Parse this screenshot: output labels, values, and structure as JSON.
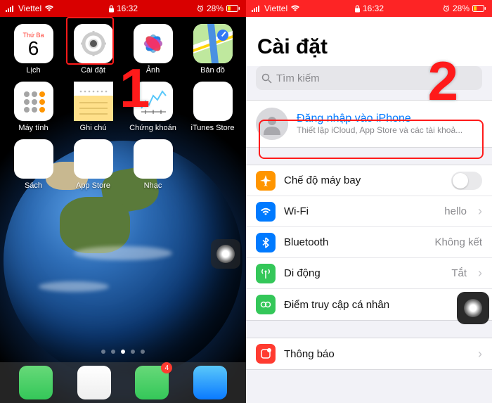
{
  "status": {
    "carrier": "Viettel",
    "time": "16:32",
    "battery_pct": "28%"
  },
  "annotations": {
    "step1": "1",
    "step2": "2"
  },
  "home": {
    "calendar": {
      "dow": "Thứ Ba",
      "day": "6"
    },
    "apps": [
      {
        "label": "Lịch"
      },
      {
        "label": "Cài đặt"
      },
      {
        "label": "Ảnh"
      },
      {
        "label": "Bản đồ"
      },
      {
        "label": "Máy tính"
      },
      {
        "label": "Ghi chú"
      },
      {
        "label": "Chứng khoán"
      },
      {
        "label": "iTunes Store"
      },
      {
        "label": "Sách"
      },
      {
        "label": "App Store"
      },
      {
        "label": "Nhạc"
      }
    ],
    "dock_badge": "4"
  },
  "settings": {
    "title": "Cài đặt",
    "search_placeholder": "Tìm kiếm",
    "signin": {
      "title": "Đăng nhập vào iPhone",
      "subtitle": "Thiết lập iCloud, App Store và các tài khoả..."
    },
    "rows": {
      "airplane": "Chế độ máy bay",
      "wifi": "Wi-Fi",
      "wifi_val": "hello",
      "bluetooth": "Bluetooth",
      "bluetooth_val": "Không kết",
      "cellular": "Di động",
      "cellular_val": "Tắt",
      "hotspot": "Điểm truy cập cá nhân",
      "notifications": "Thông báo"
    }
  }
}
